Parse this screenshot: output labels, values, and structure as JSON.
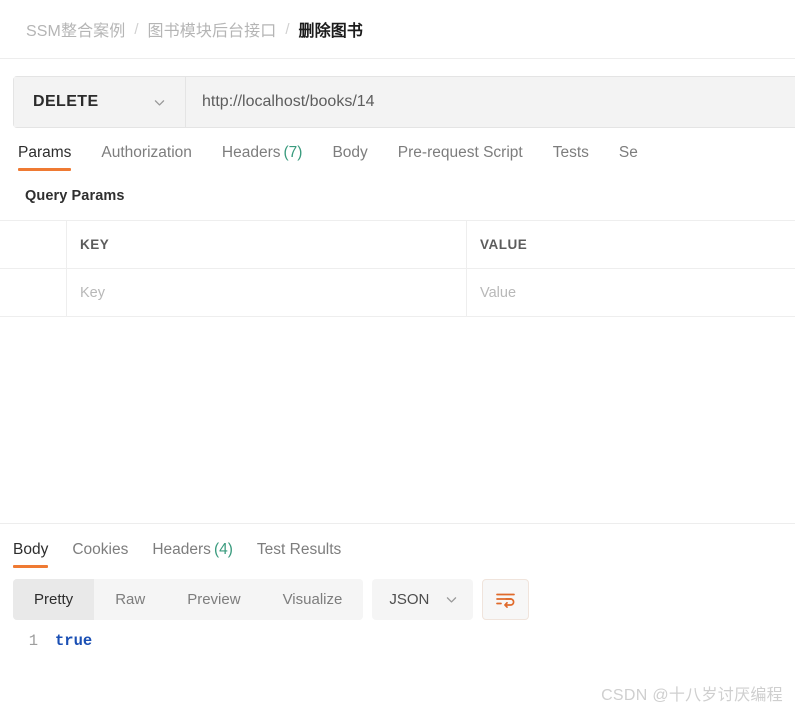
{
  "breadcrumb": {
    "items": [
      {
        "label": "SSM整合案例",
        "current": false
      },
      {
        "label": "图书模块后台接口",
        "current": false
      },
      {
        "label": "删除图书",
        "current": true
      }
    ],
    "separator": "/"
  },
  "request": {
    "method": "DELETE",
    "method_chevron_icon": "chevron-down-icon",
    "url": "http://localhost/books/14",
    "url_placeholder": "Enter request URL"
  },
  "request_tabs": [
    {
      "label": "Params",
      "count": "",
      "active": true
    },
    {
      "label": "Authorization",
      "count": "",
      "active": false
    },
    {
      "label": "Headers",
      "count": "(7)",
      "active": false
    },
    {
      "label": "Body",
      "count": "",
      "active": false
    },
    {
      "label": "Pre-request Script",
      "count": "",
      "active": false
    },
    {
      "label": "Tests",
      "count": "",
      "active": false
    },
    {
      "label": "Se",
      "count": "",
      "active": false
    }
  ],
  "query_params": {
    "title": "Query Params",
    "columns": {
      "key": "KEY",
      "value": "VALUE"
    },
    "rows": [
      {
        "key_placeholder": "Key",
        "value_placeholder": "Value"
      }
    ]
  },
  "response_tabs": [
    {
      "label": "Body",
      "count": "",
      "active": true
    },
    {
      "label": "Cookies",
      "count": "",
      "active": false
    },
    {
      "label": "Headers",
      "count": "(4)",
      "active": false
    },
    {
      "label": "Test Results",
      "count": "",
      "active": false
    }
  ],
  "format_toolbar": {
    "segments": [
      {
        "label": "Pretty",
        "active": true
      },
      {
        "label": "Raw",
        "active": false
      },
      {
        "label": "Preview",
        "active": false
      },
      {
        "label": "Visualize",
        "active": false
      }
    ],
    "language": "JSON",
    "language_chevron_icon": "chevron-down-icon",
    "wrap_icon": "word-wrap-icon"
  },
  "response_body": {
    "lines": [
      {
        "number": "1",
        "text": "true"
      }
    ]
  },
  "watermark": "CSDN @十八岁讨厌编程",
  "colors": {
    "accent": "#ef7a33",
    "count_green": "#3a9b7e",
    "code_blue": "#1a4fb4",
    "field_bg": "#f3f3f3",
    "border": "#ededed"
  }
}
